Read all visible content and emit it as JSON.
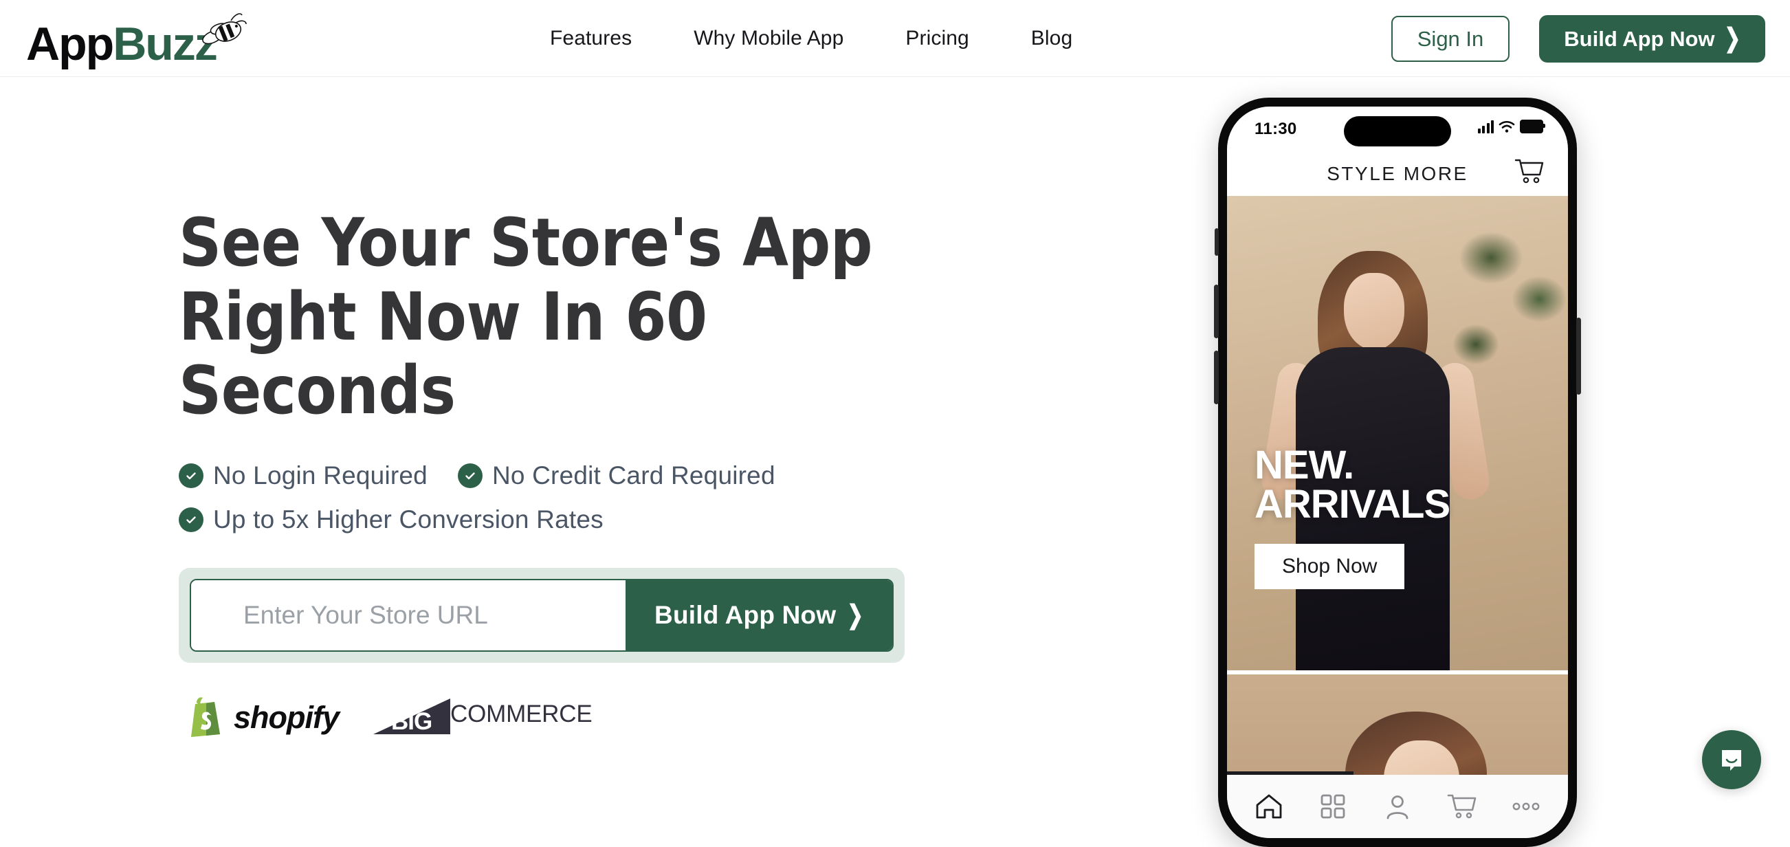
{
  "brand": {
    "name_part1": "App",
    "name_part2": "Buzz",
    "accent_green": "#2C6049",
    "mint": "#dce8e1"
  },
  "header": {
    "nav_items": [
      {
        "label": "Features"
      },
      {
        "label": "Why Mobile App"
      },
      {
        "label": "Pricing"
      },
      {
        "label": "Blog"
      }
    ],
    "sign_in_label": "Sign In",
    "cta_label": "Build App Now",
    "cta_chevron": "❯"
  },
  "hero": {
    "headline": "See Your Store's App Right Now In 60 Seconds",
    "benefits": [
      {
        "label": "No Login Required"
      },
      {
        "label": "No Credit Card Required"
      },
      {
        "label": "Up to 5x Higher Conversion Rates"
      }
    ],
    "form": {
      "input_placeholder": "Enter Your Store URL",
      "input_value": "",
      "submit_label": "Build App Now",
      "submit_chevron": "❯"
    },
    "platforms": [
      {
        "name": "shopify",
        "label": "shopify"
      },
      {
        "name": "bigcommerce",
        "label_bold": "BIG",
        "label_rest": "COMMERCE"
      }
    ]
  },
  "phone_preview": {
    "status_bar": {
      "time": "11:30",
      "signal_icon": "signal-bars-icon",
      "wifi_icon": "wifi-icon",
      "battery_icon": "battery-icon"
    },
    "app_header": {
      "title": "STYLE MORE",
      "cart_icon": "shopping-cart-icon"
    },
    "promo": {
      "line1": "NEW.",
      "line2": "ARRIVALS",
      "button_label": "Shop Now"
    },
    "tab_bar": [
      {
        "icon": "home-icon",
        "active": true
      },
      {
        "icon": "grid-icon",
        "active": false
      },
      {
        "icon": "person-icon",
        "active": false
      },
      {
        "icon": "cart-icon",
        "active": false
      },
      {
        "icon": "more-dots-icon",
        "active": false
      }
    ]
  },
  "chat_widget": {
    "icon": "chat-bubble-smile-icon",
    "color": "#2C6049"
  }
}
